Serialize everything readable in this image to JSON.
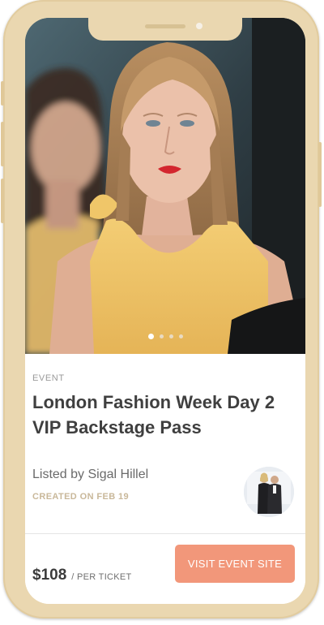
{
  "hero": {
    "image_alt": "Runway model in yellow halter top",
    "carousel": {
      "count": 4,
      "active_index": 0
    }
  },
  "event": {
    "kicker": "EVENT",
    "title": "London Fashion Week Day 2 VIP Backstage Pass",
    "listed_by": "Listed by Sigal Hillel",
    "created": "CREATED ON FEB 19"
  },
  "footer": {
    "price": "$108",
    "price_unit": "/ PER TICKET",
    "cta_label": "VISIT EVENT SITE"
  },
  "colors": {
    "frame": "#ead7b0",
    "accent": "#f2977a",
    "dress": "#f2c86a"
  }
}
